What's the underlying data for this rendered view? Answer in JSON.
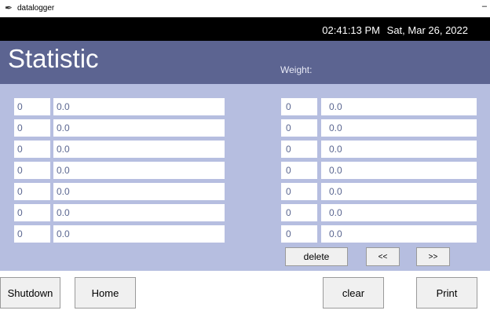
{
  "window": {
    "title": "datalogger",
    "minimize_glyph": "–",
    "icon": "feather-icon"
  },
  "clock": {
    "time": "02:41:13 PM",
    "date": "Sat, Mar 26, 2022"
  },
  "header": {
    "title": "Statistic",
    "weight_label": "Weight:"
  },
  "left_table": {
    "rows": [
      {
        "index": "0",
        "value": "0.0"
      },
      {
        "index": "0",
        "value": "0.0"
      },
      {
        "index": "0",
        "value": "0.0"
      },
      {
        "index": "0",
        "value": "0.0"
      },
      {
        "index": "0",
        "value": "0.0"
      },
      {
        "index": "0",
        "value": "0.0"
      },
      {
        "index": "0",
        "value": "0.0"
      }
    ]
  },
  "right_table": {
    "rows": [
      {
        "index": "0",
        "value": "0.0"
      },
      {
        "index": "0",
        "value": "0.0"
      },
      {
        "index": "0",
        "value": "0.0"
      },
      {
        "index": "0",
        "value": "0.0"
      },
      {
        "index": "0",
        "value": "0.0"
      },
      {
        "index": "0",
        "value": "0.0"
      },
      {
        "index": "0",
        "value": "0.0"
      }
    ]
  },
  "controls": {
    "delete_label": "delete",
    "prev_label": "<<",
    "next_label": ">>"
  },
  "footer": {
    "shutdown_label": "Shutdown",
    "home_label": "Home",
    "clear_label": "clear",
    "print_label": "Print"
  },
  "colors": {
    "header_bg": "#5c6491",
    "content_bg": "#b6bee0",
    "clock_bg": "#000000",
    "cell_text": "#5a6690"
  }
}
